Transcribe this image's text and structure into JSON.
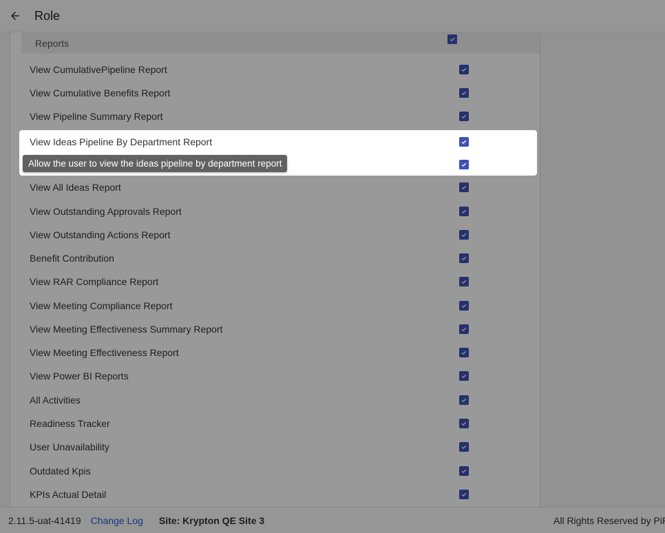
{
  "header": {
    "title": "Role",
    "back_icon": "arrow-left-icon"
  },
  "section": {
    "label": "Reports",
    "checked": true
  },
  "permissions": [
    {
      "label": "View CumulativePipeline Report",
      "checked": true
    },
    {
      "label": "View Cumulative Benefits Report",
      "checked": true
    },
    {
      "label": "View Pipeline Summary Report",
      "checked": true
    },
    {
      "label": "View Ideas Pipeline By Department Report",
      "checked": true
    },
    {
      "label": "",
      "checked": true
    },
    {
      "label": "View All Ideas Report",
      "checked": true
    },
    {
      "label": "View Outstanding Approvals Report",
      "checked": true
    },
    {
      "label": "View Outstanding Actions Report",
      "checked": true
    },
    {
      "label": "Benefit Contribution",
      "checked": true
    },
    {
      "label": "View RAR Compliance Report",
      "checked": true
    },
    {
      "label": "View Meeting Compliance Report",
      "checked": true
    },
    {
      "label": "View Meeting Effectiveness Summary Report",
      "checked": true
    },
    {
      "label": "View Meeting Effectiveness Report",
      "checked": true
    },
    {
      "label": "View Power BI Reports",
      "checked": true
    },
    {
      "label": "All Activities",
      "checked": true
    },
    {
      "label": "Readiness Tracker",
      "checked": true
    },
    {
      "label": "User Unavailability",
      "checked": true
    },
    {
      "label": "Outdated Kpis",
      "checked": true
    },
    {
      "label": "KPIs Actual Detail",
      "checked": true
    }
  ],
  "tooltip": {
    "text": "Allow the user to view the ideas pipeline by department report"
  },
  "footer": {
    "version": "2.11.5-uat-41419",
    "change_log": "Change Log",
    "site": "Site: Krypton QE Site 3",
    "rights": "All Rights Reserved by PiP"
  },
  "colors": {
    "checkbox": "#3f51b5",
    "link": "#1e5fd6",
    "tooltip_bg": "#616161"
  }
}
